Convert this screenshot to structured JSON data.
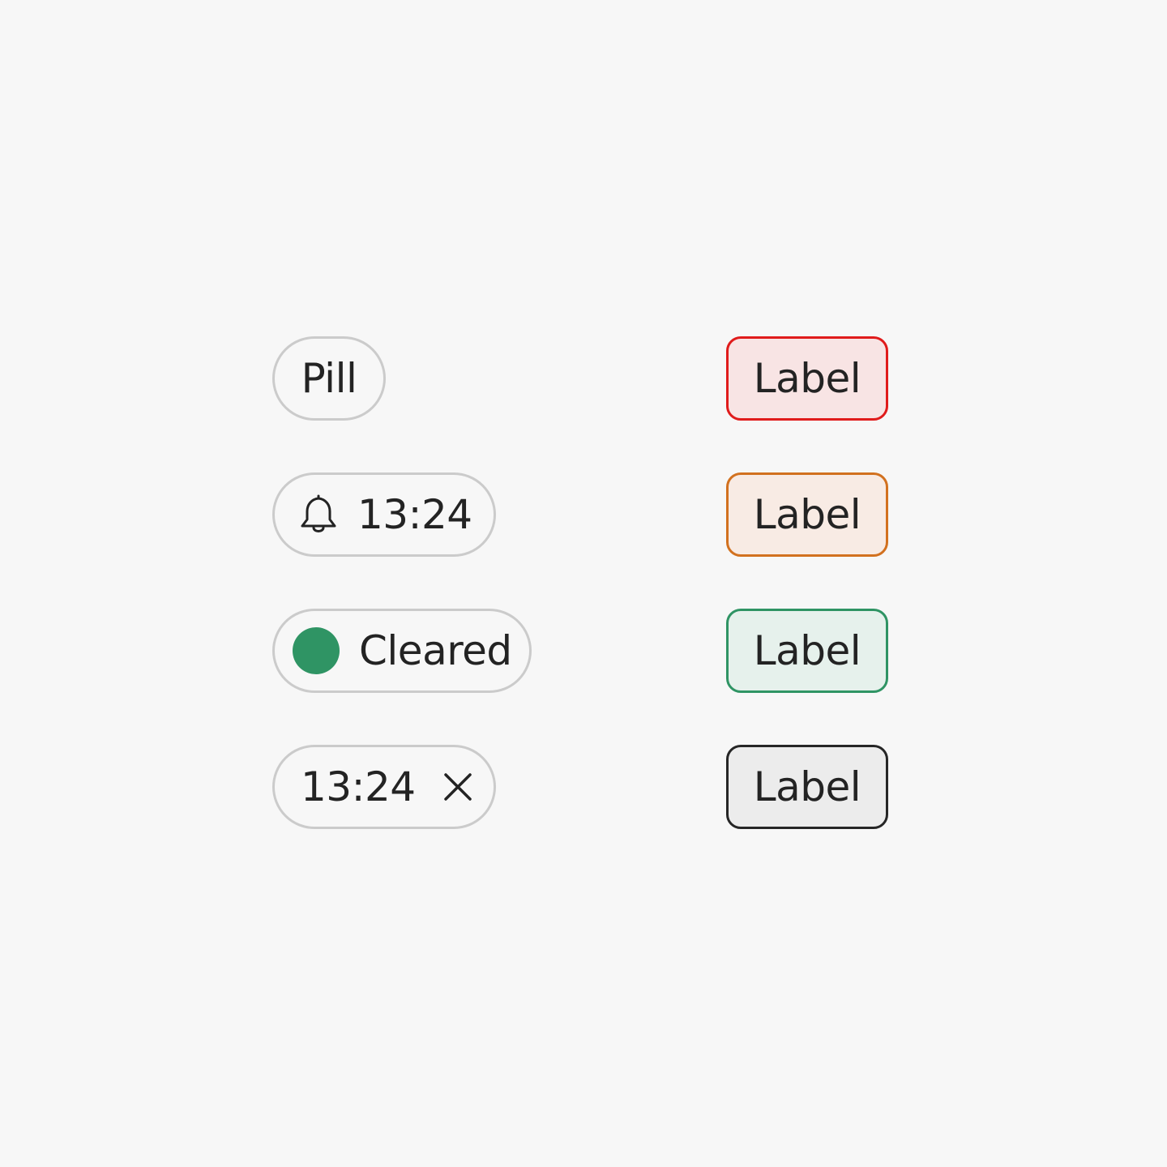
{
  "colors": {
    "background": "#f7f7f7",
    "pill_border": "#cbcbcb",
    "status_dot": "#2f9464"
  },
  "pills": [
    {
      "label": "Pill"
    },
    {
      "icon": "bell-icon",
      "label": "13:24"
    },
    {
      "indicator": "status-dot",
      "label": "Cleared"
    },
    {
      "label": "13:24",
      "icon": "close-icon"
    }
  ],
  "labels": [
    {
      "text": "Label",
      "border": "#e01b1b",
      "fill": "#f8e4e4"
    },
    {
      "text": "Label",
      "border": "#d2711f",
      "fill": "#f8ebe4"
    },
    {
      "text": "Label",
      "border": "#2f9464",
      "fill": "#e6f1ec"
    },
    {
      "text": "Label",
      "border": "#262626",
      "fill": "#ececec"
    }
  ]
}
